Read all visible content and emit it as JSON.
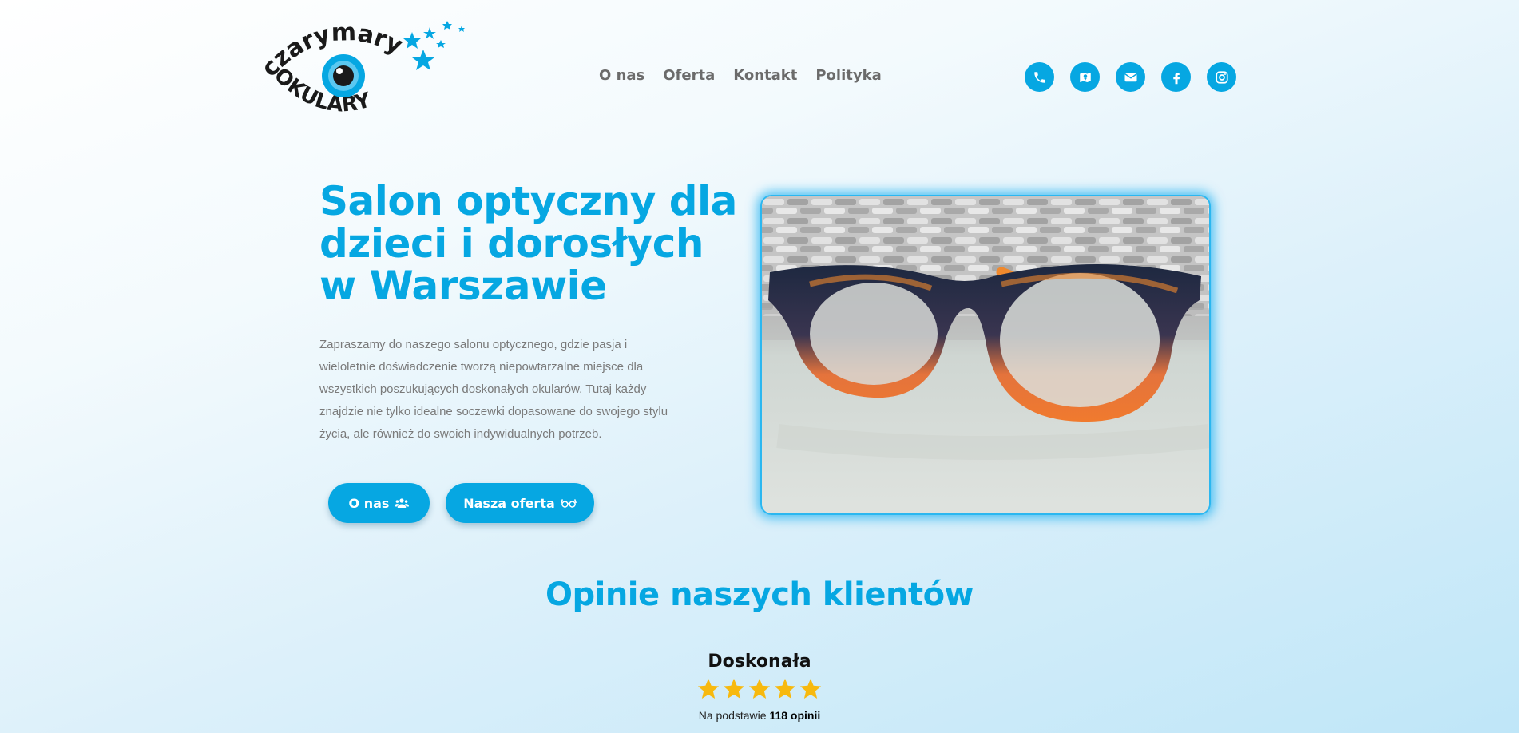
{
  "logo": {
    "line1": "czarymary",
    "line2": "OKULARY"
  },
  "nav": [
    {
      "label": "O nas"
    },
    {
      "label": "Oferta"
    },
    {
      "label": "Kontakt"
    },
    {
      "label": "Polityka"
    }
  ],
  "social_icons": [
    "phone-icon",
    "map-icon",
    "envelope-icon",
    "facebook-icon",
    "instagram-icon"
  ],
  "hero": {
    "title_lines": [
      "Salon optyczny dla",
      "dzieci i dorosłych",
      "w Warszawie"
    ],
    "text": "Zapraszamy do naszego salonu optycznego, gdzie pasja i wieloletnie doświadczenie tworzą niepowtarzalne miejsce dla wszystkich poszukujących doskonałych okularów. Tutaj każdy znajdzie nie tylko idealne soczewki dopasowane do swojego stylu życia, ale również do swoich indywidualnych potrzeb.",
    "btn_onas": "O nas",
    "btn_oferta": "Nasza oferta"
  },
  "reviews": {
    "title": "Opinie naszych klientów",
    "rating_word": "Doskonała",
    "stars": 5,
    "based_prefix": "Na podstawie",
    "based_count": "118 opinii"
  },
  "colors": {
    "accent": "#06a7e2",
    "star": "#f7b90f",
    "text_muted": "#7a7a7a"
  }
}
